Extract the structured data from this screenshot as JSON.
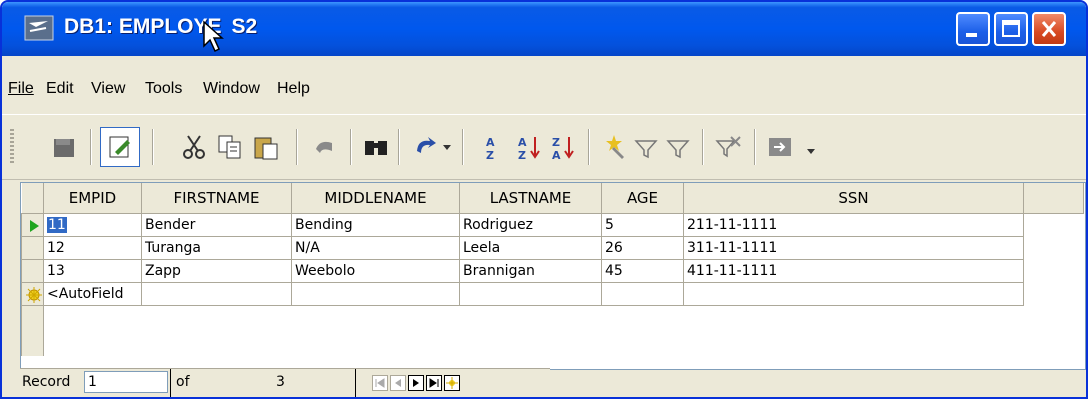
{
  "window": {
    "title": "DB1: EMPLOYEES2",
    "title_left": "DB1: EMPLOYE",
    "title_right": "S2",
    "colors": {
      "titlebar": "#0058ee",
      "accent": "#316ac5",
      "close": "#d84a23"
    }
  },
  "menu": {
    "items": [
      "File",
      "Edit",
      "View",
      "Tools",
      "Window",
      "Help"
    ]
  },
  "toolbar": {
    "icons": [
      "save-icon",
      "edit-mode-icon",
      "cut-icon",
      "copy-icon",
      "paste-icon",
      "undo-icon",
      "find-icon",
      "refresh-icon",
      "sort-icon",
      "sort-ascending-icon",
      "sort-descending-icon",
      "autofilter-icon",
      "filter-icon",
      "standard-filter-icon",
      "remove-filter-icon",
      "data-to-text-icon"
    ]
  },
  "grid": {
    "columns": [
      "EMPID",
      "FIRSTNAME",
      "MIDDLENAME",
      "LASTNAME",
      "AGE",
      "SSN"
    ],
    "rows": [
      [
        "11",
        "Bender",
        "Bending",
        "Rodriguez",
        "5",
        "211-11-1111"
      ],
      [
        "12",
        "Turanga",
        "N/A",
        "Leela",
        "26",
        "311-11-1111"
      ],
      [
        "13",
        "Zapp",
        "Weebolo",
        "Brannigan",
        "45",
        "411-11-1111"
      ]
    ],
    "new_row_placeholder": "<AutoField"
  },
  "status": {
    "record_label": "Record",
    "record_value": "1",
    "of_label": "of",
    "total": "3"
  }
}
